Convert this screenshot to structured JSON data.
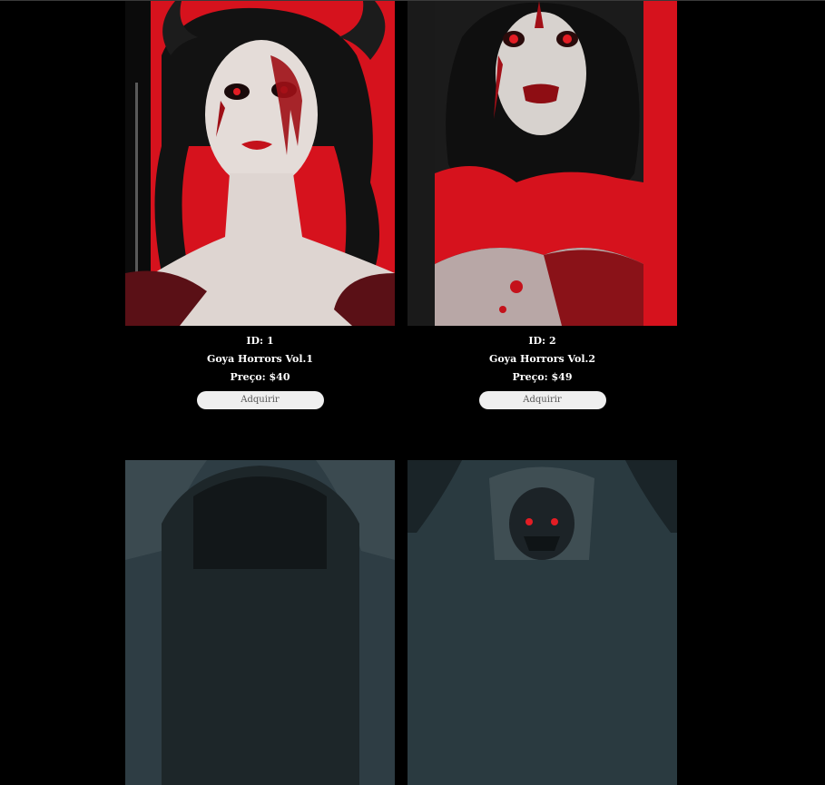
{
  "products": [
    {
      "id_label": "ID: 1",
      "name": "Goya Horrors Vol.1",
      "price_label": "Preço: $40",
      "button_label": "Adquirir",
      "cover_icon": "horned-woman-cover",
      "accent": "#d6121d"
    },
    {
      "id_label": "ID: 2",
      "name": "Goya Horrors Vol.2",
      "price_label": "Preço: $49",
      "button_label": "Adquirir",
      "cover_icon": "bleeding-woman-cover",
      "accent": "#d6121d"
    },
    {
      "cover_icon": "dark-haired-figure-cover",
      "accent": "#2e3d44"
    },
    {
      "cover_icon": "tree-creature-cover",
      "accent": "#2a3a40"
    }
  ],
  "colors": {
    "background": "#000000",
    "text": "#ffffff",
    "button_bg": "#efefef",
    "button_text": "#555555"
  }
}
